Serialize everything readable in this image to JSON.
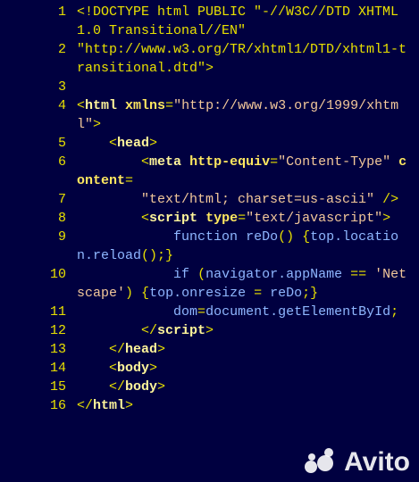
{
  "lines": [
    {
      "n": "1",
      "parts": [
        {
          "c": "p",
          "t": "<!DOCTYPE html PUBLIC \"-//W3C//DTD XHTML 1.0 Transitional//EN\""
        }
      ]
    },
    {
      "n": "2",
      "parts": [
        {
          "c": "p",
          "t": "\"http://www.w3.org/TR/xhtml1/DTD/xhtml1-transitional.dtd\">"
        }
      ]
    },
    {
      "n": "3",
      "parts": []
    },
    {
      "n": "4",
      "parts": [
        {
          "c": "p",
          "t": "<"
        },
        {
          "c": "t",
          "t": "html"
        },
        {
          "c": "w",
          "t": " "
        },
        {
          "c": "a",
          "t": "xmlns"
        },
        {
          "c": "p",
          "t": "="
        },
        {
          "c": "s",
          "t": "\"http://www.w3.org/1999/xhtml\""
        },
        {
          "c": "p",
          "t": ">"
        }
      ]
    },
    {
      "n": "5",
      "parts": [
        {
          "c": "w",
          "t": "    "
        },
        {
          "c": "p",
          "t": "<"
        },
        {
          "c": "t",
          "t": "head"
        },
        {
          "c": "p",
          "t": ">"
        }
      ]
    },
    {
      "n": "6",
      "parts": [
        {
          "c": "w",
          "t": "        "
        },
        {
          "c": "p",
          "t": "<"
        },
        {
          "c": "t",
          "t": "meta"
        },
        {
          "c": "w",
          "t": " "
        },
        {
          "c": "a",
          "t": "http-equiv"
        },
        {
          "c": "p",
          "t": "="
        },
        {
          "c": "s",
          "t": "\"Content-Type\""
        },
        {
          "c": "w",
          "t": " "
        },
        {
          "c": "a",
          "t": "content"
        },
        {
          "c": "p",
          "t": "="
        }
      ]
    },
    {
      "n": "7",
      "parts": [
        {
          "c": "w",
          "t": "        "
        },
        {
          "c": "s",
          "t": "\"text/html; charset=us-ascii\""
        },
        {
          "c": "w",
          "t": " "
        },
        {
          "c": "p",
          "t": "/>"
        }
      ]
    },
    {
      "n": "8",
      "parts": [
        {
          "c": "w",
          "t": "        "
        },
        {
          "c": "p",
          "t": "<"
        },
        {
          "c": "t",
          "t": "script"
        },
        {
          "c": "w",
          "t": " "
        },
        {
          "c": "a",
          "t": "type"
        },
        {
          "c": "p",
          "t": "="
        },
        {
          "c": "s",
          "t": "\"text/javascript\""
        },
        {
          "c": "p",
          "t": ">"
        }
      ]
    },
    {
      "n": "9",
      "parts": [
        {
          "c": "w",
          "t": "            "
        },
        {
          "c": "k",
          "t": "function"
        },
        {
          "c": "w",
          "t": " "
        },
        {
          "c": "fn",
          "t": "reDo"
        },
        {
          "c": "p",
          "t": "()"
        },
        {
          "c": "w",
          "t": " "
        },
        {
          "c": "p",
          "t": "{"
        },
        {
          "c": "fn",
          "t": "top.location.reload"
        },
        {
          "c": "p",
          "t": "();}"
        }
      ]
    },
    {
      "n": "10",
      "parts": [
        {
          "c": "w",
          "t": "            "
        },
        {
          "c": "k",
          "t": "if"
        },
        {
          "c": "w",
          "t": " "
        },
        {
          "c": "p",
          "t": "("
        },
        {
          "c": "fn",
          "t": "navigator.appName"
        },
        {
          "c": "w",
          "t": " "
        },
        {
          "c": "p",
          "t": "=="
        },
        {
          "c": "w",
          "t": " "
        },
        {
          "c": "s",
          "t": "'Netscape'"
        },
        {
          "c": "p",
          "t": ")"
        },
        {
          "c": "w",
          "t": " "
        },
        {
          "c": "p",
          "t": "{"
        },
        {
          "c": "fn",
          "t": "top.onresize"
        },
        {
          "c": "w",
          "t": " "
        },
        {
          "c": "p",
          "t": "="
        },
        {
          "c": "w",
          "t": " "
        },
        {
          "c": "fn",
          "t": "reDo"
        },
        {
          "c": "p",
          "t": ";}"
        }
      ]
    },
    {
      "n": "11",
      "parts": [
        {
          "c": "w",
          "t": "            "
        },
        {
          "c": "fn",
          "t": "dom"
        },
        {
          "c": "p",
          "t": "="
        },
        {
          "c": "fn",
          "t": "document.getElementById"
        },
        {
          "c": "p",
          "t": ";"
        }
      ]
    },
    {
      "n": "12",
      "parts": [
        {
          "c": "w",
          "t": "        "
        },
        {
          "c": "p",
          "t": "</"
        },
        {
          "c": "t",
          "t": "script"
        },
        {
          "c": "p",
          "t": ">"
        }
      ]
    },
    {
      "n": "13",
      "parts": [
        {
          "c": "w",
          "t": "    "
        },
        {
          "c": "p",
          "t": "</"
        },
        {
          "c": "t",
          "t": "head"
        },
        {
          "c": "p",
          "t": ">"
        }
      ]
    },
    {
      "n": "14",
      "parts": [
        {
          "c": "w",
          "t": "    "
        },
        {
          "c": "p",
          "t": "<"
        },
        {
          "c": "t",
          "t": "body"
        },
        {
          "c": "p",
          "t": ">"
        }
      ]
    },
    {
      "n": "15",
      "parts": [
        {
          "c": "w",
          "t": "    "
        },
        {
          "c": "p",
          "t": "</"
        },
        {
          "c": "t",
          "t": "body"
        },
        {
          "c": "p",
          "t": ">"
        }
      ]
    },
    {
      "n": "16",
      "parts": [
        {
          "c": "p",
          "t": "</"
        },
        {
          "c": "t",
          "t": "html"
        },
        {
          "c": "p",
          "t": ">"
        }
      ]
    }
  ],
  "watermark": {
    "text": "Avito"
  },
  "colors": {
    "background": "#000040",
    "line_numbers": "#e8e000",
    "tags": "#fff59a",
    "strings": "#f3c89a",
    "keywords": "#8fb7ff"
  }
}
